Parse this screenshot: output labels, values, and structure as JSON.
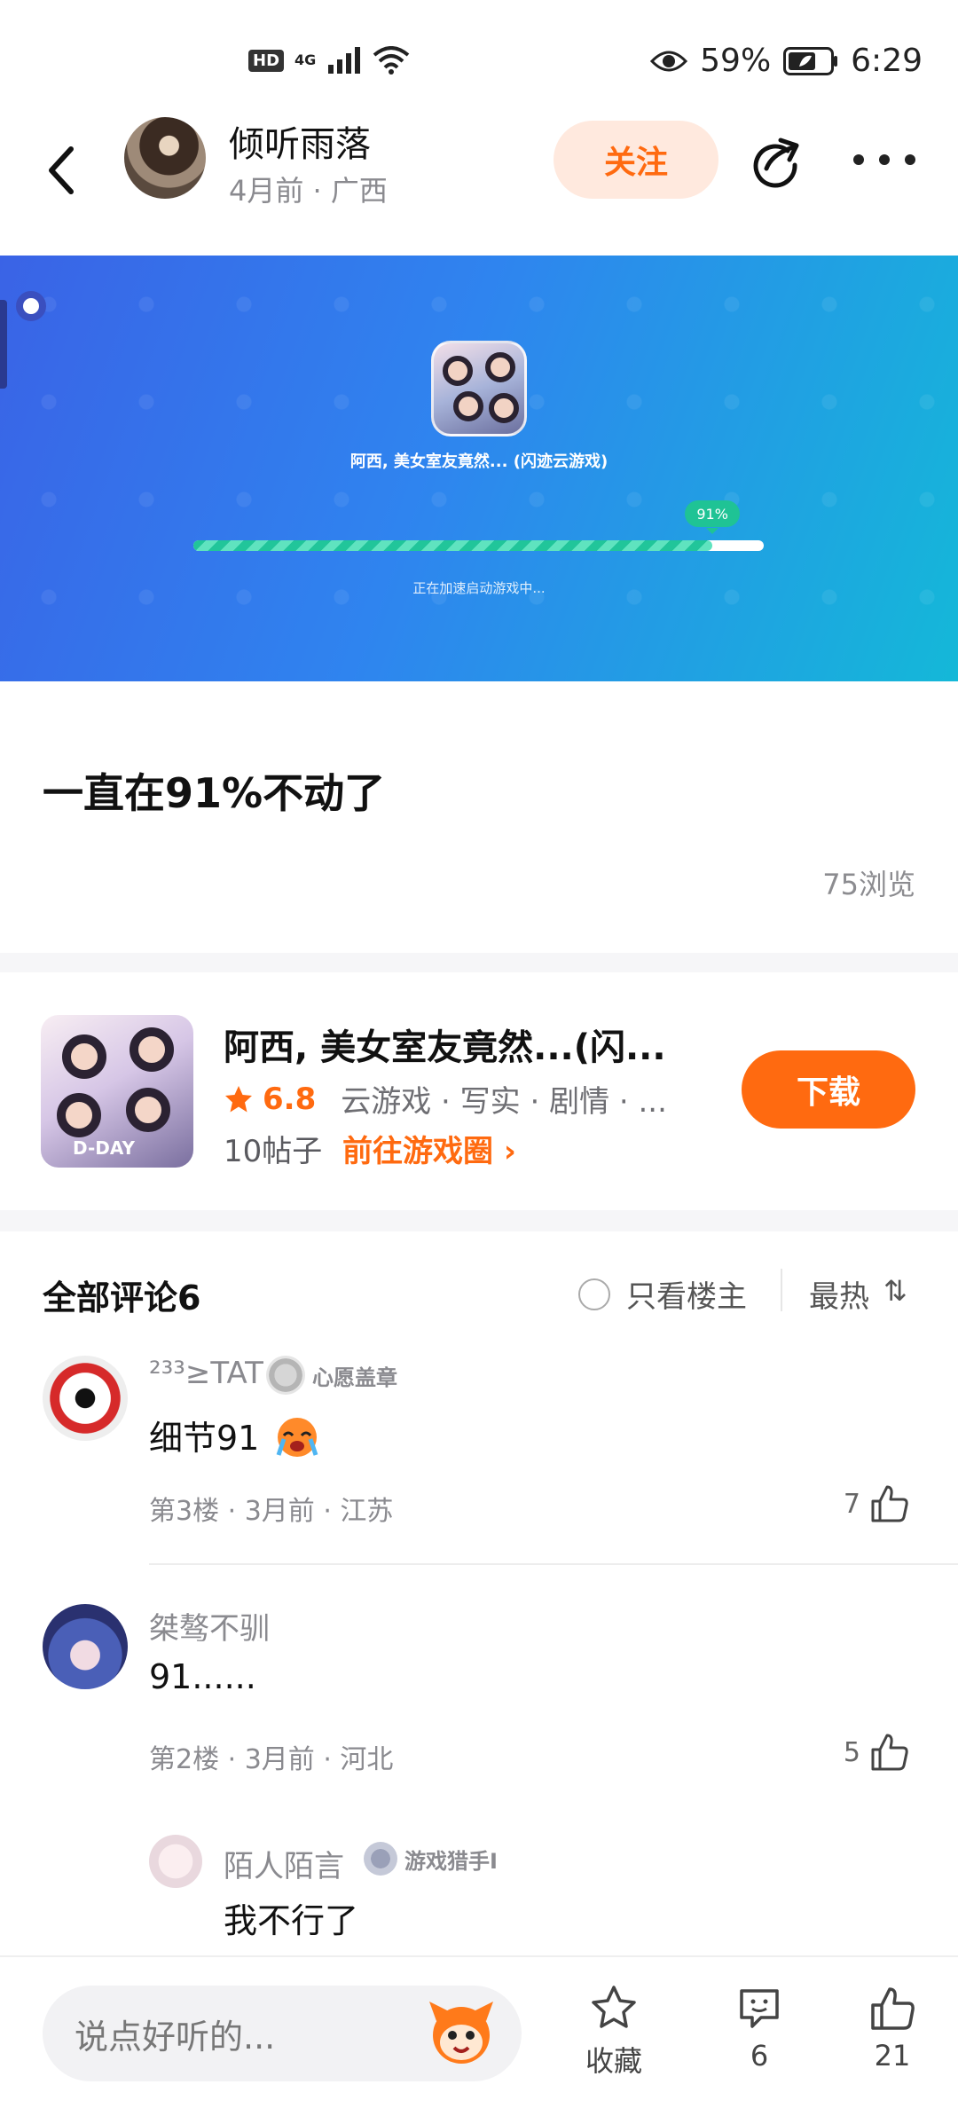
{
  "status_bar": {
    "network": "HD",
    "signal": "4G",
    "battery": "59%",
    "time": "6:29"
  },
  "post": {
    "author": {
      "name": "倾听雨落",
      "meta": "4月前 · 广西"
    },
    "follow_label": "关注",
    "banner": {
      "game_title": "阿西, 美女室友竟然... (闪迹云游戏)",
      "progress": 0.91,
      "progress_label": "91%",
      "status": "正在加速启动游戏中..."
    },
    "title": "一直在91%不动了",
    "views": "75浏览"
  },
  "game_card": {
    "thumb_label": "D-DAY",
    "title": "阿西, 美女室友竟然...(闪...",
    "rating": "6.8",
    "tags": "云游戏 · 写实 · 剧情 · ...",
    "posts": "10帖子",
    "circle_link": "前往游戏圈 ›",
    "download_label": "下载"
  },
  "comments": {
    "header": "全部评论6",
    "only_op_label": "只看楼主",
    "sort_label": "最热",
    "sort_icon": "⇅",
    "items": [
      {
        "name": "²³³≥TAT",
        "badge": "心愿盖章",
        "text": "细节91",
        "meta": "第3楼 · 3月前 · 江苏",
        "likes": "7"
      },
      {
        "name": "桀骜不驯",
        "badge": "",
        "text": "91......",
        "meta": "第2楼 · 3月前 · 河北",
        "likes": "5"
      },
      {
        "name": "陌人陌言",
        "badge": "游戏猎手I",
        "text": "我不行了",
        "meta": "",
        "likes": ""
      }
    ]
  },
  "bottom_bar": {
    "input_placeholder": "说点好听的...",
    "favorite_label": "收藏",
    "comment_count": "6",
    "like_count": "21"
  },
  "colors": {
    "accent": "#ff6a10",
    "follow_bg": "#ffe9de",
    "progress": "#1fc395"
  }
}
